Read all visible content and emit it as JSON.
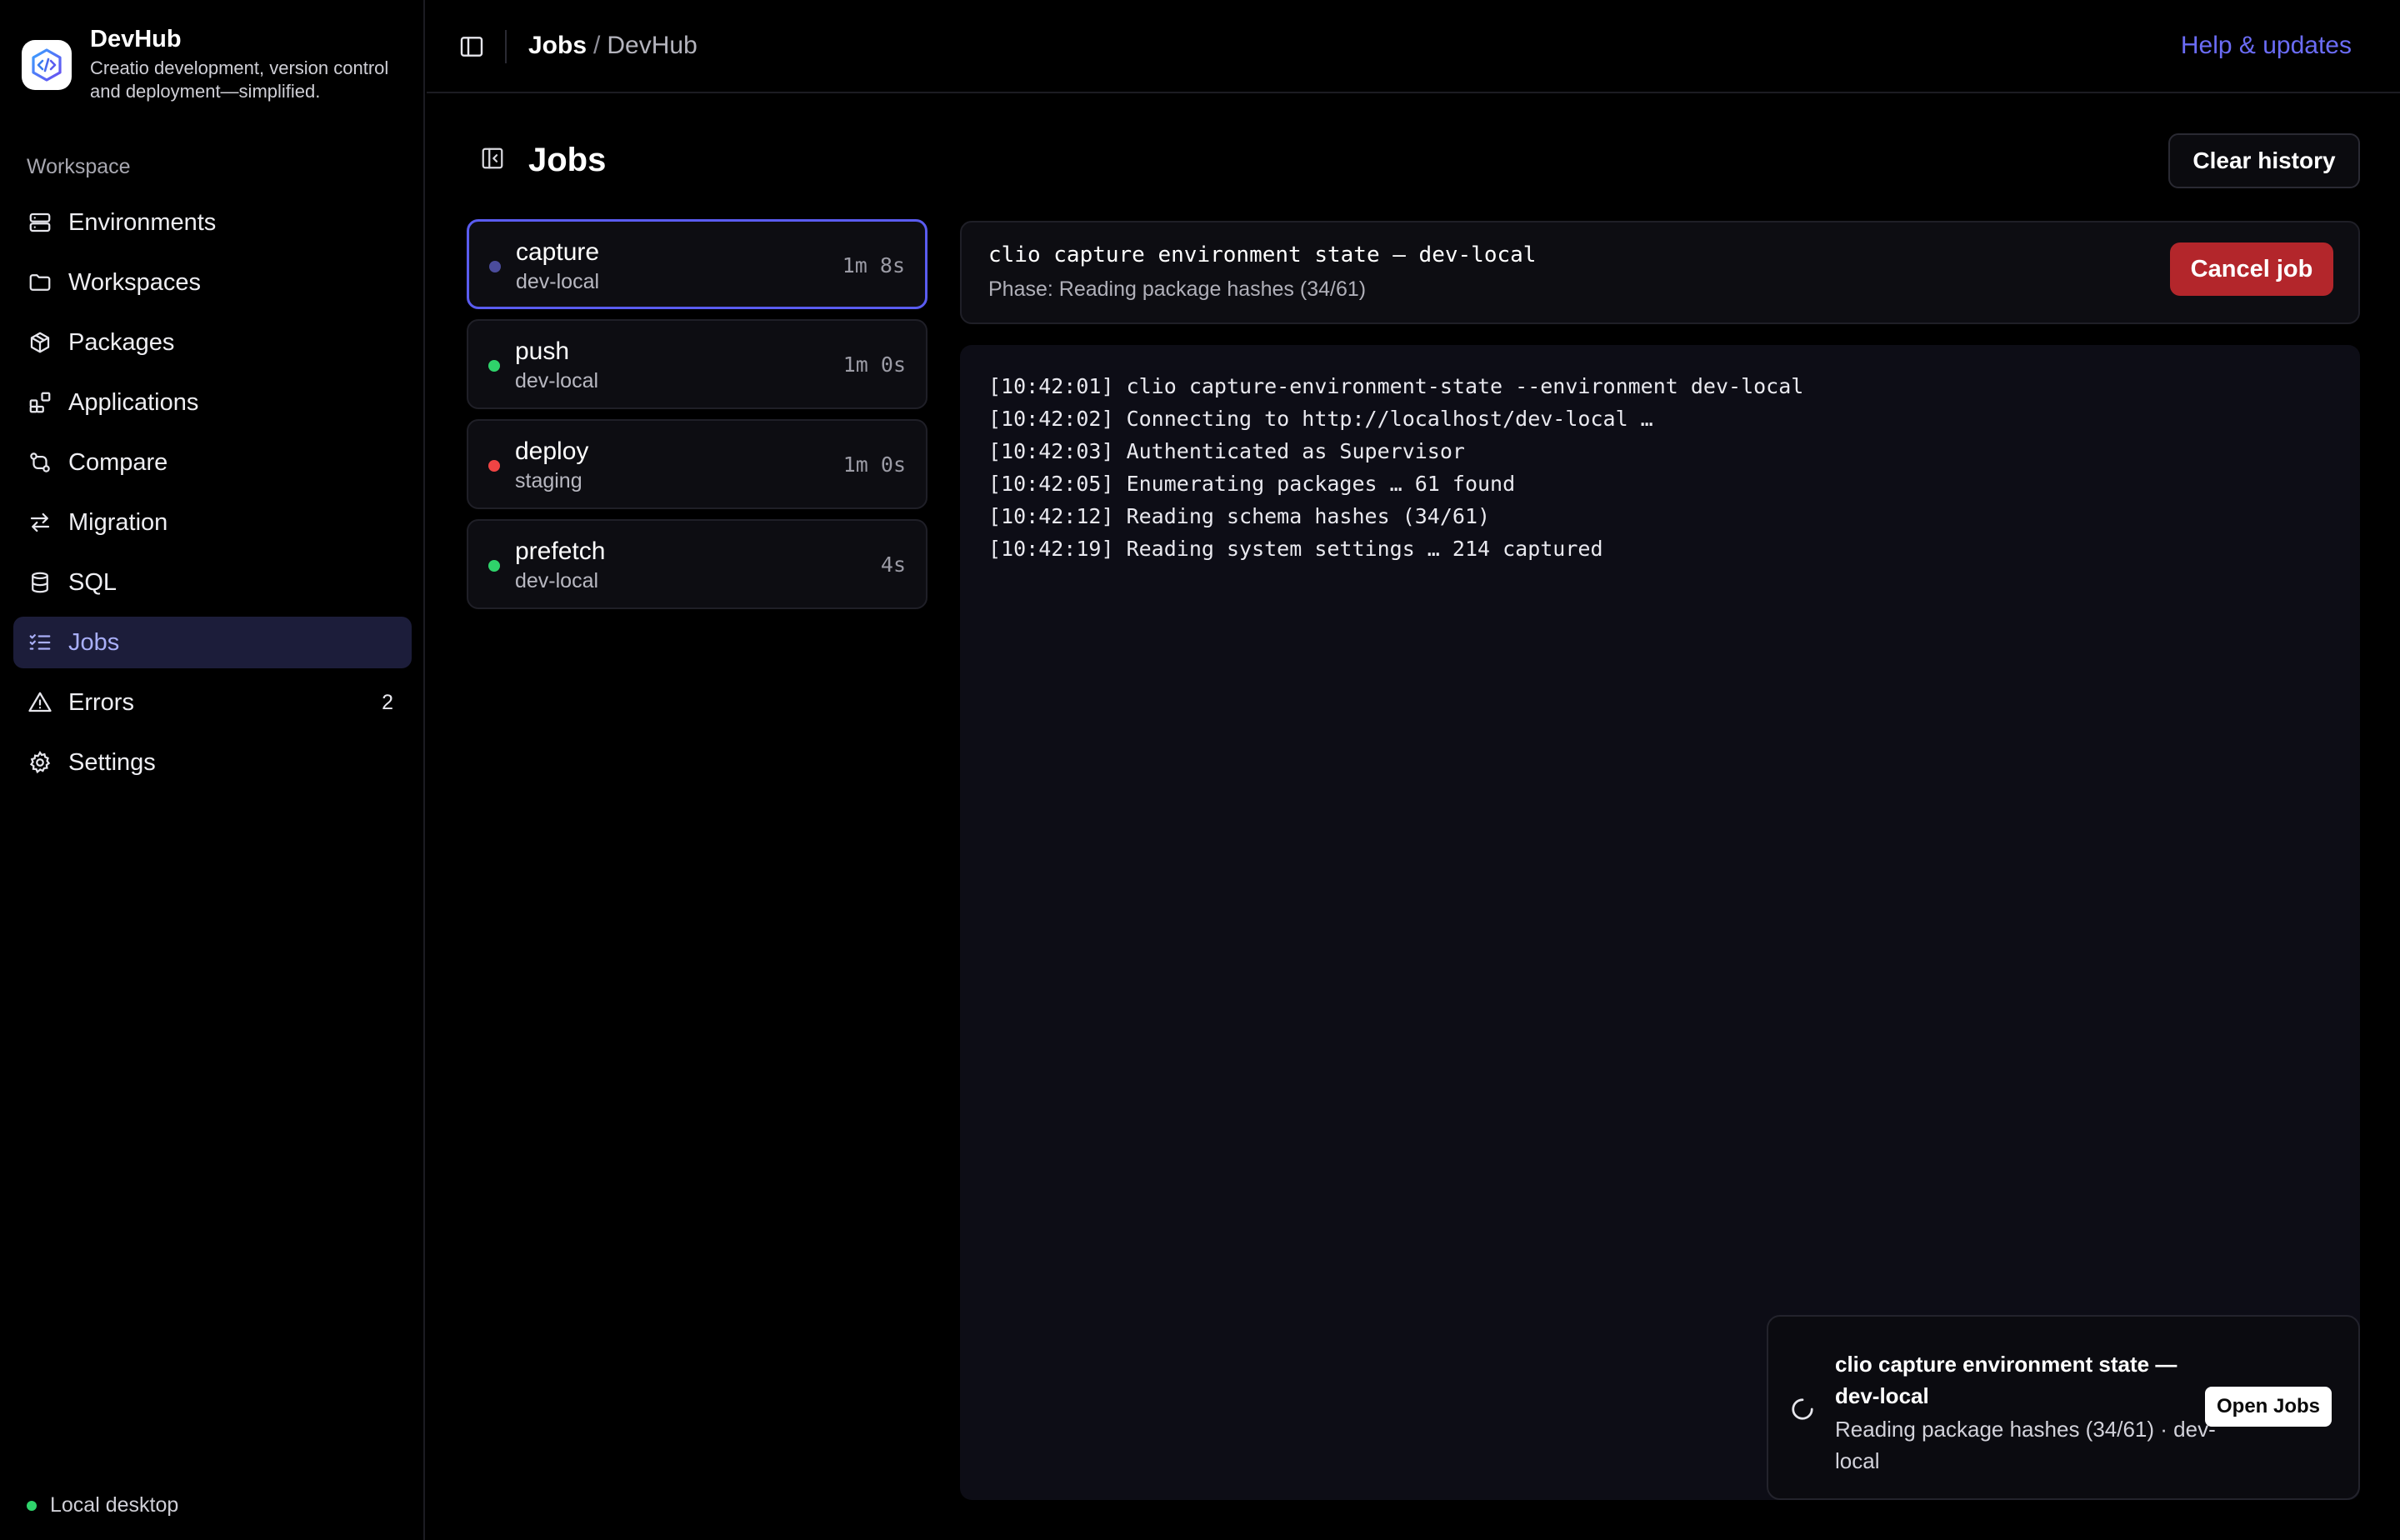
{
  "app": {
    "name": "DevHub",
    "tagline": "Creatio development, version control and deployment—simplified."
  },
  "sidebar": {
    "section_label": "Workspace",
    "items": [
      {
        "label": "Environments",
        "icon": "server-icon",
        "count": ""
      },
      {
        "label": "Workspaces",
        "icon": "folder-icon",
        "count": ""
      },
      {
        "label": "Packages",
        "icon": "package-icon",
        "count": ""
      },
      {
        "label": "Applications",
        "icon": "apps-icon",
        "count": ""
      },
      {
        "label": "Compare",
        "icon": "compare-icon",
        "count": ""
      },
      {
        "label": "Migration",
        "icon": "arrows-swap-icon",
        "count": ""
      },
      {
        "label": "SQL",
        "icon": "database-icon",
        "count": ""
      },
      {
        "label": "Jobs",
        "icon": "list-checks-icon",
        "count": "",
        "active": true
      },
      {
        "label": "Errors",
        "icon": "warning-icon",
        "count": "2"
      },
      {
        "label": "Settings",
        "icon": "gear-icon",
        "count": ""
      }
    ],
    "footer_status": "Local desktop"
  },
  "topbar": {
    "breadcrumb_current": "Jobs",
    "breadcrumb_separator": "/",
    "breadcrumb_parent": "DevHub",
    "help_link": "Help & updates"
  },
  "page": {
    "title": "Jobs",
    "clear_history_label": "Clear history"
  },
  "jobs": [
    {
      "name": "capture",
      "env": "dev-local",
      "duration": "1m 8s",
      "status": "running",
      "status_color": "#4b4c9c",
      "selected": true
    },
    {
      "name": "push",
      "env": "dev-local",
      "duration": "1m 0s",
      "status": "success",
      "status_color": "#2fd36b",
      "selected": false
    },
    {
      "name": "deploy",
      "env": "staging",
      "duration": "1m 0s",
      "status": "failed",
      "status_color": "#ef4444",
      "selected": false
    },
    {
      "name": "prefetch",
      "env": "dev-local",
      "duration": "4s",
      "status": "success",
      "status_color": "#2fd36b",
      "selected": false
    }
  ],
  "job_detail": {
    "title": "clio capture environment state — dev-local",
    "phase": "Phase: Reading package hashes (34/61)",
    "cancel_label": "Cancel job",
    "log": [
      "[10:42:01] clio capture-environment-state --environment dev-local",
      "[10:42:02] Connecting to http://localhost/dev-local …",
      "[10:42:03] Authenticated as Supervisor",
      "[10:42:05] Enumerating packages … 61 found",
      "[10:42:12] Reading schema hashes (34/61)",
      "[10:42:19] Reading system settings … 214 captured"
    ]
  },
  "toast": {
    "title": "clio capture environment state — dev-local",
    "subtitle": "Reading package hashes (34/61) · dev-local",
    "action_label": "Open Jobs"
  },
  "colors": {
    "accent": "#5a5cf0",
    "link": "#6b6cf6",
    "danger": "#b3262b",
    "success": "#2fd36b",
    "active_nav_bg": "#1c1d3a"
  }
}
